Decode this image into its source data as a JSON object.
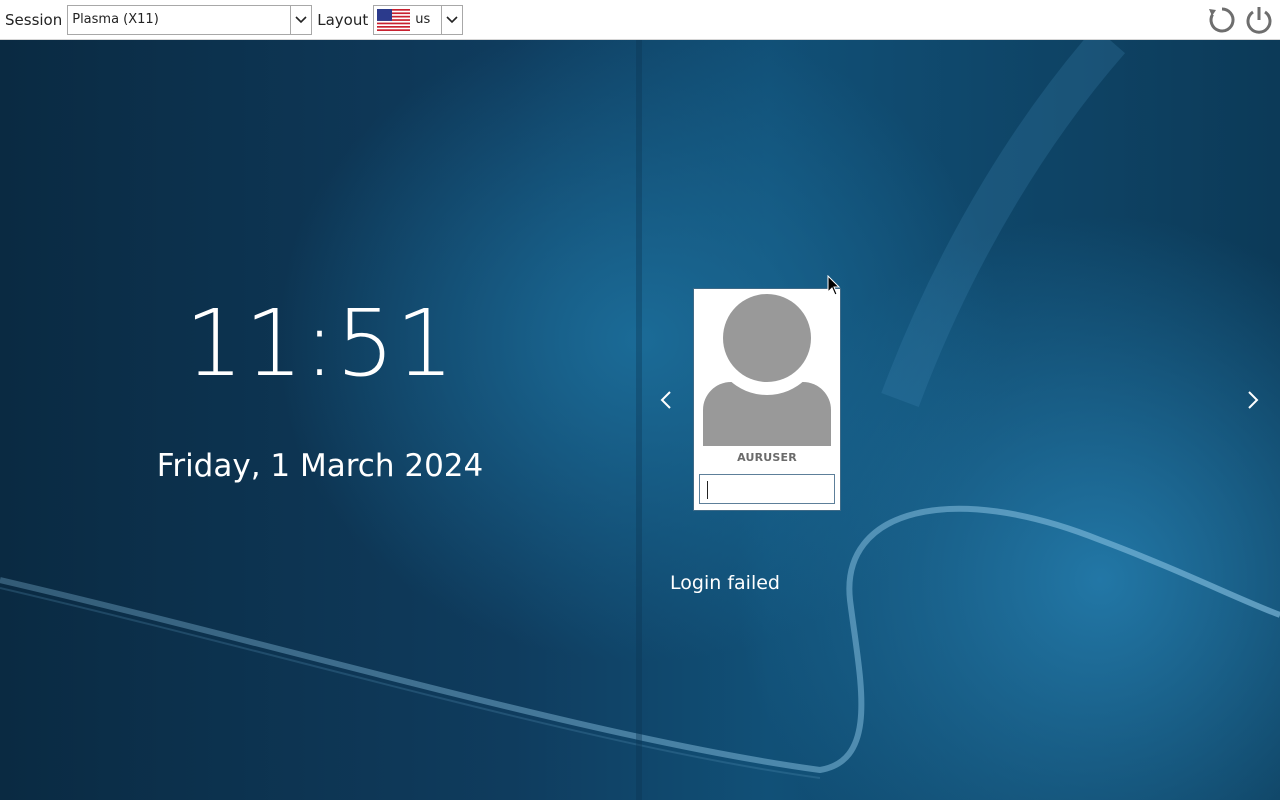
{
  "topbar": {
    "session_label": "Session",
    "session_value": "Plasma (X11)",
    "layout_label": "Layout",
    "layout_value": "us",
    "layout_flag_icon": "us-flag-icon",
    "reboot_icon": "reboot-icon",
    "shutdown_icon": "power-icon"
  },
  "clock": {
    "time": "11:51",
    "date": "Friday, 1 March 2024"
  },
  "login": {
    "username": "AURUSER",
    "password_value": "",
    "status_message": "Login failed"
  },
  "colors": {
    "background_dark": "#0a2a42",
    "background_accent": "#1b6b97",
    "avatar_gray": "#999999"
  }
}
